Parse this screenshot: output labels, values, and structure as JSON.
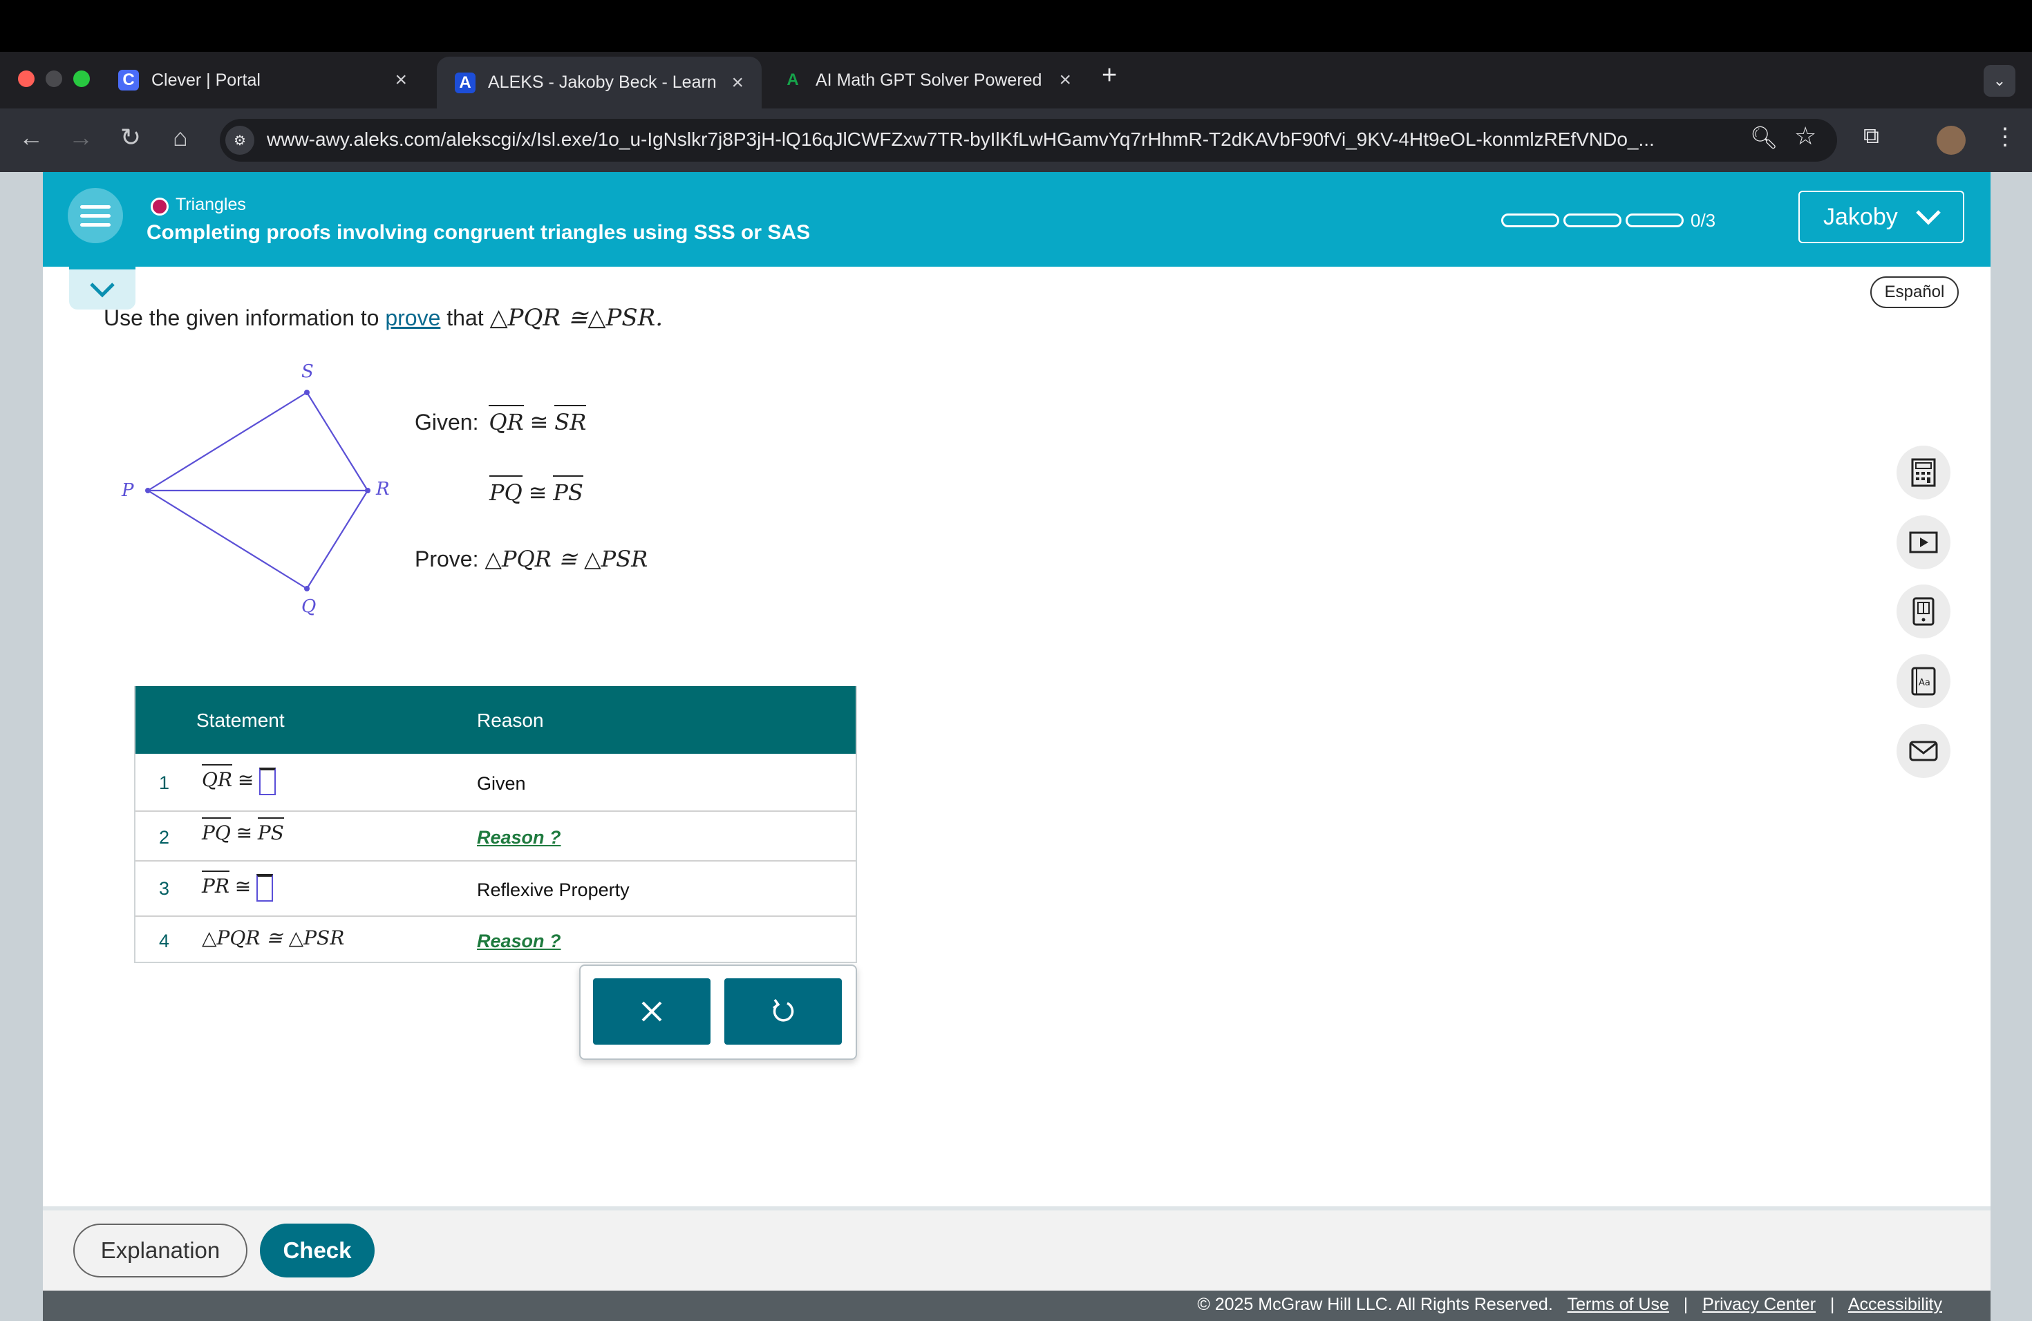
{
  "browser": {
    "tabs": [
      {
        "label": "Clever | Portal",
        "favicon": "C",
        "color": "#4a6cf7"
      },
      {
        "label": "ALEKS - Jakoby Beck - Learn",
        "favicon": "A",
        "color": "#1d4ed8"
      },
      {
        "label": "AI Math GPT Solver Powered",
        "favicon": "A",
        "color": "#16a34a"
      }
    ],
    "new_tab": "+",
    "url": "www-awy.aleks.com/alekscgi/x/Isl.exe/1o_u-IgNslkr7j8P3jH-lQ16qJlCWFZxw7TR-byIlKfLwHGamvYq7rHhmR-T2dKAVbF90fVi_9KV-4Ht9eOL-konmlzREfVNDo_..."
  },
  "header": {
    "topic": "Triangles",
    "title": "Completing proofs involving congruent triangles using SSS or SAS",
    "progress": "0/3",
    "progress_completed": 0,
    "progress_total": 3,
    "user": "Jakoby",
    "language_button": "Español"
  },
  "problem": {
    "instruction_pre": "Use the given information to",
    "instruction_link": "prove",
    "instruction_post": "that",
    "target": "△PQR ≅△PSR.",
    "given_label": "Given:",
    "given1_a": "QR",
    "given1_b": "SR",
    "given2_a": "PQ",
    "given2_b": "PS",
    "prove_label": "Prove:",
    "prove_stmt": "△PQR ≅ △PSR",
    "cong": "≅"
  },
  "figure": {
    "vertices": {
      "S": "S",
      "P": "P",
      "R": "R",
      "Q": "Q"
    },
    "color": "#5b50d6"
  },
  "table": {
    "headers": {
      "statement": "Statement",
      "reason": "Reason"
    },
    "rows": [
      {
        "num": "1",
        "stmt_a": "QR",
        "stmt_b": "",
        "reason": "Given"
      },
      {
        "num": "2",
        "stmt_a": "PQ",
        "stmt_b": "PS",
        "reason": "Reason ?"
      },
      {
        "num": "3",
        "stmt_a": "PR",
        "stmt_b": "",
        "reason": "Reflexive Property"
      },
      {
        "num": "4",
        "stmt_full": "△PQR ≅ △PSR",
        "reason": "Reason ?"
      }
    ]
  },
  "popup": {
    "clear_icon": "close-icon",
    "undo_icon": "undo-icon"
  },
  "side_tools": [
    "calculator-icon",
    "video-icon",
    "ebook-icon",
    "dictionary-icon",
    "mail-icon"
  ],
  "bottom": {
    "explanation": "Explanation",
    "check": "Check"
  },
  "footer": {
    "copyright": "© 2025 McGraw Hill LLC. All Rights Reserved.",
    "terms": "Terms of Use",
    "privacy": "Privacy Center",
    "accessibility": "Accessibility",
    "sep": "|"
  }
}
